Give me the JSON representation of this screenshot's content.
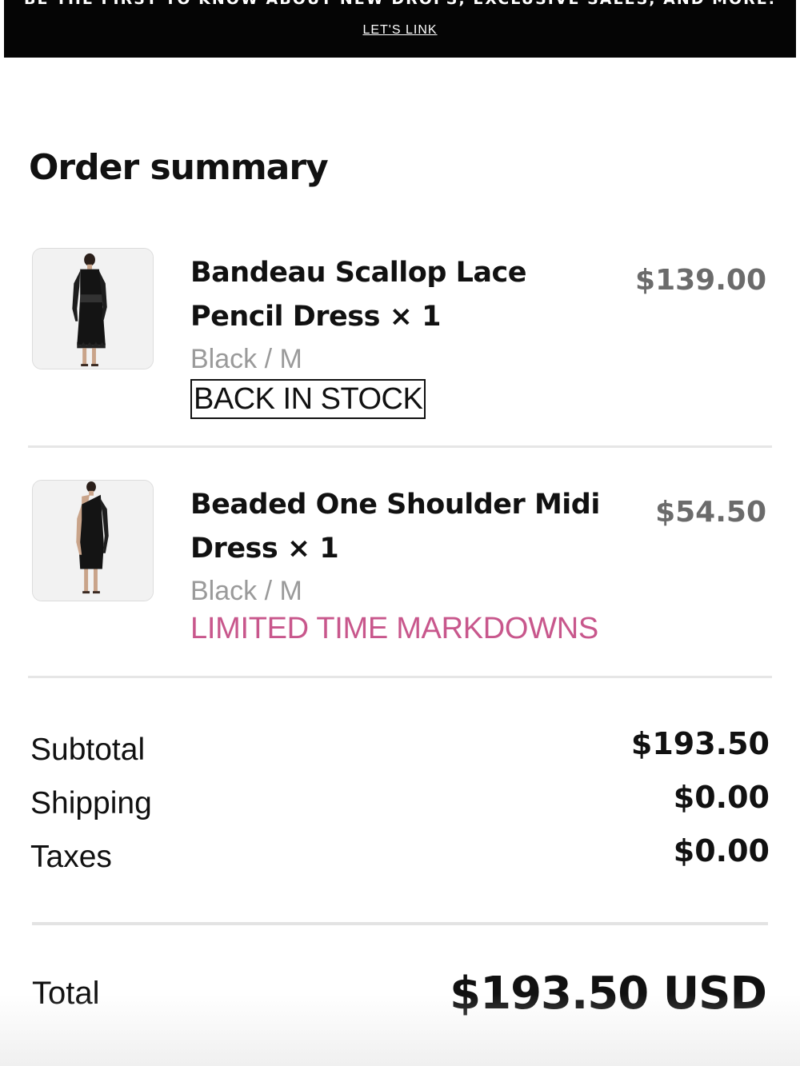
{
  "banner": {
    "text": "BE THE FIRST TO KNOW ABOUT NEW DROPS, EXCLUSIVE SALES, AND MORE.",
    "link_label": "LET'S LINK"
  },
  "order_summary": {
    "title": "Order summary",
    "items": [
      {
        "name": "Bandeau Scallop Lace Pencil Dress × 1",
        "variant": "Black / M",
        "badge": "BACK IN STOCK",
        "price": "$139.00"
      },
      {
        "name": "Beaded One Shoulder Midi Dress × 1",
        "variant": "Black / M",
        "badge": "LIMITED TIME MARKDOWNS",
        "price": "$54.50"
      }
    ],
    "totals": [
      {
        "label": "Subtotal",
        "value": "$193.50"
      },
      {
        "label": "Shipping",
        "value": "$0.00"
      },
      {
        "label": "Taxes",
        "value": "$0.00"
      }
    ],
    "grand_total": {
      "label": "Total",
      "value": "$193.50 USD"
    }
  },
  "colors": {
    "banner_bg": "#050505",
    "markdown_accent": "#c8578c",
    "muted_text": "#9a9a9a",
    "price_text": "#6b6b6b"
  }
}
